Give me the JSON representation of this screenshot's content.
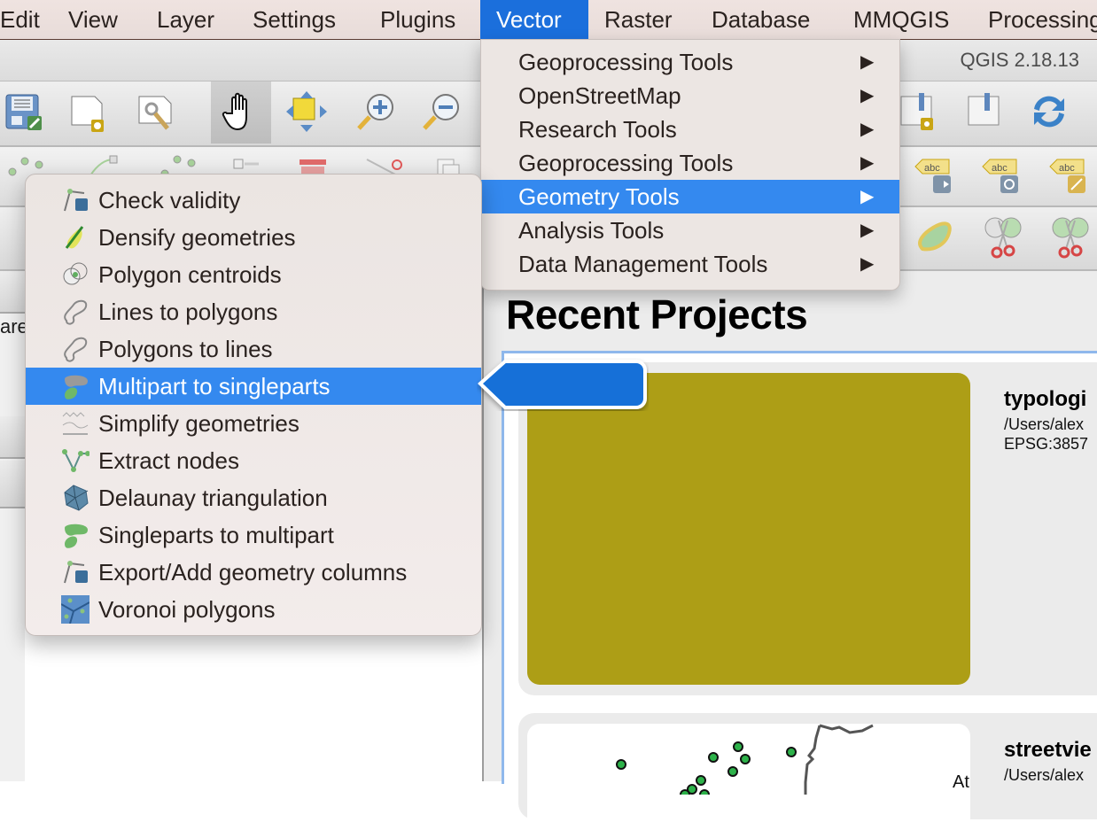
{
  "menubar": {
    "items": [
      {
        "label": "Edit"
      },
      {
        "label": "View"
      },
      {
        "label": "Layer"
      },
      {
        "label": "Settings"
      },
      {
        "label": "Plugins"
      },
      {
        "label": "Vector",
        "active": true
      },
      {
        "label": "Raster"
      },
      {
        "label": "Database"
      },
      {
        "label": "MMQGIS"
      },
      {
        "label": "Processing"
      }
    ]
  },
  "window": {
    "title": "QGIS 2.18.13"
  },
  "toolbar1": {
    "icons": [
      "save-edits-icon",
      "new-shapefile-icon",
      "layer-properties-icon",
      "pan-icon",
      "pan-to-selection-icon",
      "zoom-in-icon",
      "zoom-out-icon",
      "new-bookmark-icon",
      "show-bookmarks-icon",
      "refresh-icon"
    ]
  },
  "vector_menu": {
    "items": [
      {
        "label": "Geoprocessing Tools",
        "submenu": true
      },
      {
        "label": "OpenStreetMap",
        "submenu": true
      },
      {
        "label": "Research Tools",
        "submenu": true
      },
      {
        "label": "Geoprocessing Tools",
        "submenu": true
      },
      {
        "label": "Geometry Tools",
        "submenu": true,
        "highlighted": true
      },
      {
        "label": "Analysis Tools",
        "submenu": true
      },
      {
        "label": "Data Management Tools",
        "submenu": true
      }
    ],
    "submenu_arrow": "▶"
  },
  "geometry_menu": {
    "items": [
      {
        "label": "Check validity",
        "icon": "check-validity-icon"
      },
      {
        "label": "Densify geometries",
        "icon": "densify-icon"
      },
      {
        "label": "Polygon centroids",
        "icon": "centroids-icon"
      },
      {
        "label": "Lines to polygons",
        "icon": "lines-to-polygons-icon"
      },
      {
        "label": "Polygons to lines",
        "icon": "polygons-to-lines-icon"
      },
      {
        "label": "Multipart to singleparts",
        "icon": "multipart-to-singleparts-icon",
        "highlighted": true
      },
      {
        "label": "Simplify geometries",
        "icon": "simplify-icon"
      },
      {
        "label": "Extract nodes",
        "icon": "extract-nodes-icon"
      },
      {
        "label": "Delaunay triangulation",
        "icon": "delaunay-icon"
      },
      {
        "label": "Singleparts to multipart",
        "icon": "singleparts-to-multipart-icon"
      },
      {
        "label": "Export/Add geometry columns",
        "icon": "export-geometry-columns-icon"
      },
      {
        "label": "Voronoi polygons",
        "icon": "voronoi-icon"
      }
    ]
  },
  "left_panel": {
    "partial_label": "are"
  },
  "recent_projects": {
    "title": "Recent Projects",
    "projects": [
      {
        "name": "typologi",
        "path": "/Users/alex",
        "crs": "EPSG:3857",
        "thumb_color": "#ad9e16"
      },
      {
        "name": "streetvie",
        "path": "/Users/alex",
        "map_label": "At"
      }
    ]
  },
  "colors": {
    "menu_highlight": "#3489ef",
    "menubar_active": "#1b6fdc",
    "callout": "#1270d8"
  }
}
